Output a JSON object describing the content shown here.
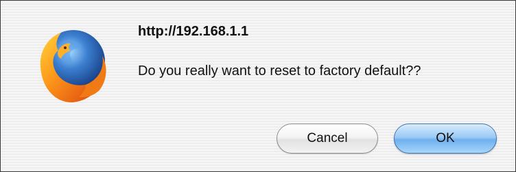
{
  "dialog": {
    "title": "http://192.168.1.1",
    "message": "Do you really want to reset to factory default??",
    "icon": "firefox-logo-icon"
  },
  "buttons": {
    "cancel_label": "Cancel",
    "ok_label": "OK"
  },
  "colors": {
    "ok_button_accent": "#8cc2f3",
    "dialog_background": "#f0f0f0"
  }
}
